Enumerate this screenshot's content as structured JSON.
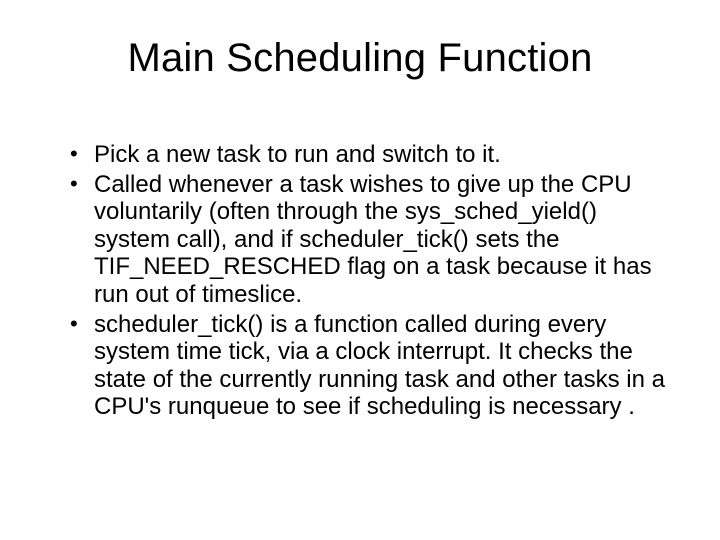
{
  "slide": {
    "title": "Main Scheduling Function",
    "bullets": [
      "Pick a new task to run and switch to it.",
      "Called whenever a task wishes to give up the CPU voluntarily (often through the sys_sched_yield() system call), and if scheduler_tick() sets the TIF_NEED_RESCHED flag on a task because it has run out of timeslice.",
      "scheduler_tick() is a function called during every system time tick, via a clock interrupt. It checks the state of the currently running task and other tasks in a CPU's runqueue to see if scheduling is necessary ."
    ]
  }
}
